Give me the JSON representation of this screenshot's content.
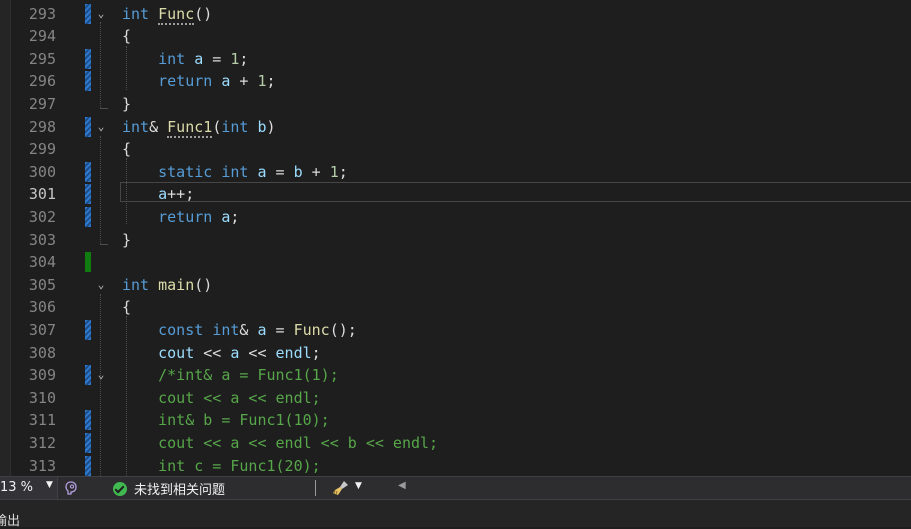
{
  "editor": {
    "current_line": "301",
    "lines": [
      {
        "no": "293",
        "marker": "mod",
        "fold": "⌄",
        "tokens": [
          {
            "t": "int",
            "c": "kw"
          },
          {
            "t": " ",
            "c": ""
          },
          {
            "t": "Func",
            "c": "fn squig"
          },
          {
            "t": "()",
            "c": ""
          }
        ]
      },
      {
        "no": "294",
        "marker": "",
        "fold": "",
        "tokens": [
          {
            "t": "{",
            "c": ""
          }
        ]
      },
      {
        "no": "295",
        "marker": "mod",
        "fold": "",
        "tokens": [
          {
            "t": "    ",
            "c": ""
          },
          {
            "t": "int",
            "c": "kw"
          },
          {
            "t": " ",
            "c": ""
          },
          {
            "t": "a",
            "c": "var"
          },
          {
            "t": " = ",
            "c": ""
          },
          {
            "t": "1",
            "c": "num"
          },
          {
            "t": ";",
            "c": ""
          }
        ]
      },
      {
        "no": "296",
        "marker": "mod",
        "fold": "",
        "tokens": [
          {
            "t": "    ",
            "c": ""
          },
          {
            "t": "return",
            "c": "kw"
          },
          {
            "t": " ",
            "c": ""
          },
          {
            "t": "a",
            "c": "var"
          },
          {
            "t": " + ",
            "c": ""
          },
          {
            "t": "1",
            "c": "num"
          },
          {
            "t": ";",
            "c": ""
          }
        ]
      },
      {
        "no": "297",
        "marker": "",
        "fold": "",
        "tokens": [
          {
            "t": "}",
            "c": ""
          }
        ]
      },
      {
        "no": "298",
        "marker": "mod",
        "fold": "⌄",
        "tokens": [
          {
            "t": "int",
            "c": "kw"
          },
          {
            "t": "& ",
            "c": ""
          },
          {
            "t": "Func1",
            "c": "fn squig"
          },
          {
            "t": "(",
            "c": ""
          },
          {
            "t": "int",
            "c": "kw"
          },
          {
            "t": " ",
            "c": ""
          },
          {
            "t": "b",
            "c": "var"
          },
          {
            "t": ")",
            "c": ""
          }
        ]
      },
      {
        "no": "299",
        "marker": "",
        "fold": "",
        "tokens": [
          {
            "t": "{",
            "c": ""
          }
        ]
      },
      {
        "no": "300",
        "marker": "mod",
        "fold": "",
        "tokens": [
          {
            "t": "    ",
            "c": ""
          },
          {
            "t": "static",
            "c": "kw"
          },
          {
            "t": " ",
            "c": ""
          },
          {
            "t": "int",
            "c": "kw"
          },
          {
            "t": " ",
            "c": ""
          },
          {
            "t": "a",
            "c": "var"
          },
          {
            "t": " = ",
            "c": ""
          },
          {
            "t": "b",
            "c": "var"
          },
          {
            "t": " + ",
            "c": ""
          },
          {
            "t": "1",
            "c": "num"
          },
          {
            "t": ";",
            "c": ""
          }
        ]
      },
      {
        "no": "301",
        "marker": "mod",
        "fold": "",
        "tokens": [
          {
            "t": "    ",
            "c": ""
          },
          {
            "t": "a",
            "c": "var"
          },
          {
            "t": "++;",
            "c": ""
          }
        ]
      },
      {
        "no": "302",
        "marker": "mod",
        "fold": "",
        "tokens": [
          {
            "t": "    ",
            "c": ""
          },
          {
            "t": "return",
            "c": "kw"
          },
          {
            "t": " ",
            "c": ""
          },
          {
            "t": "a",
            "c": "var"
          },
          {
            "t": ";",
            "c": ""
          }
        ]
      },
      {
        "no": "303",
        "marker": "",
        "fold": "",
        "tokens": [
          {
            "t": "}",
            "c": ""
          }
        ]
      },
      {
        "no": "304",
        "marker": "save",
        "fold": "",
        "tokens": []
      },
      {
        "no": "305",
        "marker": "",
        "fold": "⌄",
        "tokens": [
          {
            "t": "int",
            "c": "kw"
          },
          {
            "t": " ",
            "c": ""
          },
          {
            "t": "main",
            "c": "fn"
          },
          {
            "t": "()",
            "c": ""
          }
        ]
      },
      {
        "no": "306",
        "marker": "",
        "fold": "",
        "tokens": [
          {
            "t": "{",
            "c": ""
          }
        ]
      },
      {
        "no": "307",
        "marker": "mod",
        "fold": "",
        "tokens": [
          {
            "t": "    ",
            "c": ""
          },
          {
            "t": "const",
            "c": "kw"
          },
          {
            "t": " ",
            "c": ""
          },
          {
            "t": "int",
            "c": "kw"
          },
          {
            "t": "& ",
            "c": ""
          },
          {
            "t": "a",
            "c": "var"
          },
          {
            "t": " = ",
            "c": ""
          },
          {
            "t": "Func",
            "c": "fn"
          },
          {
            "t": "();",
            "c": ""
          }
        ]
      },
      {
        "no": "308",
        "marker": "",
        "fold": "",
        "tokens": [
          {
            "t": "    ",
            "c": ""
          },
          {
            "t": "cout",
            "c": "var"
          },
          {
            "t": " << ",
            "c": ""
          },
          {
            "t": "a",
            "c": "var"
          },
          {
            "t": " << ",
            "c": ""
          },
          {
            "t": "endl",
            "c": "var"
          },
          {
            "t": ";",
            "c": ""
          }
        ]
      },
      {
        "no": "309",
        "marker": "mod",
        "fold": "⌄",
        "tokens": [
          {
            "t": "    ",
            "c": ""
          },
          {
            "t": "/*int& a = Func1(1);",
            "c": "cm"
          }
        ]
      },
      {
        "no": "310",
        "marker": "",
        "fold": "",
        "tokens": [
          {
            "t": "    ",
            "c": ""
          },
          {
            "t": "cout << a << endl;",
            "c": "cm"
          }
        ]
      },
      {
        "no": "311",
        "marker": "mod",
        "fold": "",
        "tokens": [
          {
            "t": "    ",
            "c": ""
          },
          {
            "t": "int& b = Func1(10);",
            "c": "cm"
          }
        ]
      },
      {
        "no": "312",
        "marker": "mod",
        "fold": "",
        "tokens": [
          {
            "t": "    ",
            "c": ""
          },
          {
            "t": "cout << a << endl << b << endl;",
            "c": "cm"
          }
        ]
      },
      {
        "no": "313",
        "marker": "mod",
        "fold": "",
        "tokens": [
          {
            "t": "    ",
            "c": ""
          },
          {
            "t": "int c = Func1(20);",
            "c": "cm"
          }
        ]
      }
    ]
  },
  "statusbar": {
    "zoom": "13 %",
    "issues_text": "未找到相关问题"
  },
  "output_panel": {
    "label": "输出"
  }
}
